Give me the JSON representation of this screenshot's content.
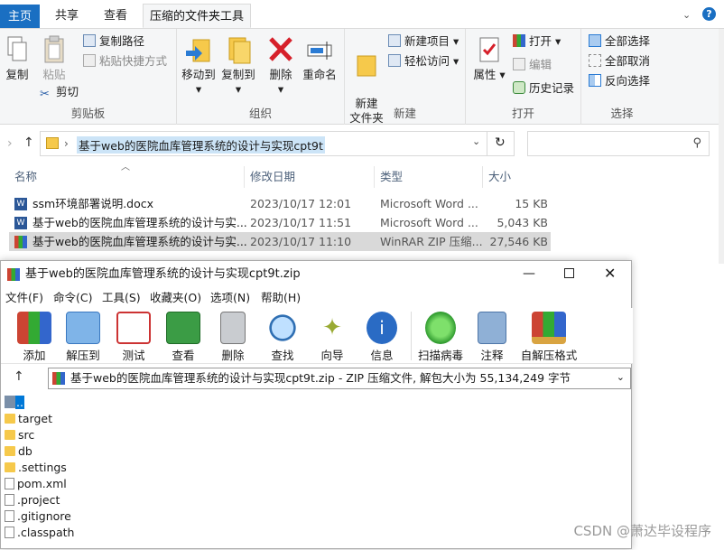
{
  "explorer": {
    "tabs": [
      "主页",
      "共享",
      "查看",
      "压缩的文件夹工具"
    ],
    "ribbon": {
      "clipboard": {
        "label": "剪贴板",
        "copy": "复制",
        "paste": "粘贴",
        "copy_path": "复制路径",
        "paste_shortcut": "粘贴快捷方式",
        "cut": "剪切"
      },
      "organize": {
        "label": "组织",
        "move_to": "移动到",
        "copy_to": "复制到",
        "delete": "删除",
        "rename": "重命名"
      },
      "new": {
        "label": "新建",
        "new_folder": "新建\n文件夹",
        "new_item": "新建项目",
        "easy_access": "轻松访问"
      },
      "open": {
        "label": "打开",
        "properties": "属性",
        "open": "打开",
        "edit": "编辑",
        "history": "历史记录"
      },
      "select": {
        "label": "选择",
        "select_all": "全部选择",
        "select_none": "全部取消",
        "invert": "反向选择"
      }
    },
    "address": "基于web的医院血库管理系统的设计与实现cpt9t",
    "columns": [
      "名称",
      "修改日期",
      "类型",
      "大小"
    ],
    "files": [
      {
        "name": "ssm环境部署说明.docx",
        "date": "2023/10/17 12:01",
        "type": "Microsoft Word ...",
        "size": "15 KB",
        "icon": "word-icon"
      },
      {
        "name": "基于web的医院血库管理系统的设计与实...",
        "date": "2023/10/17 11:51",
        "type": "Microsoft Word ...",
        "size": "5,043 KB",
        "icon": "word-icon"
      },
      {
        "name": "基于web的医院血库管理系统的设计与实...",
        "date": "2023/10/17 11:10",
        "type": "WinRAR ZIP 压缩...",
        "size": "27,546 KB",
        "icon": "winrar-icon"
      }
    ]
  },
  "winrar": {
    "title": "基于web的医院血库管理系统的设计与实现cpt9t.zip",
    "menu": [
      "文件(F)",
      "命令(C)",
      "工具(S)",
      "收藏夹(O)",
      "选项(N)",
      "帮助(H)"
    ],
    "toolbar": [
      "添加",
      "解压到",
      "测试",
      "查看",
      "删除",
      "查找",
      "向导",
      "信息",
      "扫描病毒",
      "注释",
      "自解压格式"
    ],
    "path": "基于web的医院血库管理系统的设计与实现cpt9t.zip - ZIP 压缩文件, 解包大小为 55,134,249 字节",
    "entries": [
      {
        "name": "..",
        "kind": "up"
      },
      {
        "name": "target",
        "kind": "folder"
      },
      {
        "name": "src",
        "kind": "folder"
      },
      {
        "name": "db",
        "kind": "folder"
      },
      {
        "name": ".settings",
        "kind": "folder"
      },
      {
        "name": "pom.xml",
        "kind": "file"
      },
      {
        "name": ".project",
        "kind": "file"
      },
      {
        "name": ".gitignore",
        "kind": "file"
      },
      {
        "name": ".classpath",
        "kind": "file"
      }
    ]
  },
  "watermark": "CSDN @萧达毕设程序"
}
